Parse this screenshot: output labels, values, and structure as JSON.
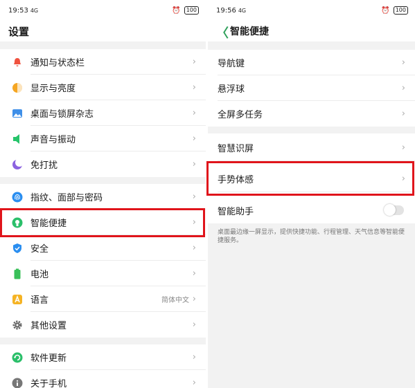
{
  "left": {
    "status": {
      "time": "19:53",
      "network": "4G",
      "battery": "100"
    },
    "title": "设置",
    "groups": [
      [
        {
          "label": "通知与状态栏",
          "icon": "bell-icon",
          "color": "#f0523f"
        },
        {
          "label": "显示与亮度",
          "icon": "brightness-icon",
          "color": "#f5a623"
        },
        {
          "label": "桌面与锁屏杂志",
          "icon": "wallpaper-icon",
          "color": "#3f8fe8"
        },
        {
          "label": "声音与振动",
          "icon": "speaker-icon",
          "color": "#27c46b"
        },
        {
          "label": "免打扰",
          "icon": "moon-icon",
          "color": "#8c63e0"
        }
      ],
      [
        {
          "label": "指纹、面部与密码",
          "icon": "fingerprint-icon",
          "color": "#2a8ef0"
        },
        {
          "label": "智能便捷",
          "icon": "smart-assist-icon",
          "color": "#2bbf6a"
        },
        {
          "label": "安全",
          "icon": "shield-icon",
          "color": "#2a8ef0"
        },
        {
          "label": "电池",
          "icon": "battery-icon",
          "color": "#3ac05a"
        },
        {
          "label": "语言",
          "icon": "language-icon",
          "color": "#f5b324",
          "value": "简体中文"
        },
        {
          "label": "其他设置",
          "icon": "gear-icon",
          "color": "#666666"
        }
      ],
      [
        {
          "label": "软件更新",
          "icon": "update-icon",
          "color": "#2bbf6a"
        },
        {
          "label": "关于手机",
          "icon": "info-icon",
          "color": "#777777"
        }
      ]
    ]
  },
  "right": {
    "status": {
      "time": "19:56",
      "network": "4G",
      "battery": "100"
    },
    "back": "〈",
    "title": "智能便捷",
    "groups": [
      [
        {
          "label": "导航键"
        },
        {
          "label": "悬浮球"
        },
        {
          "label": "全屏多任务"
        }
      ],
      [
        {
          "label": "智慧识屏"
        },
        {
          "label": "手势体感"
        },
        {
          "label": "智能助手"
        }
      ]
    ],
    "description": "桌面最边缘一屏显示，提供快捷功能、行程管理、天气信息等智能便捷服务。"
  },
  "chevron": "›",
  "highlight_color": "#e0141b"
}
